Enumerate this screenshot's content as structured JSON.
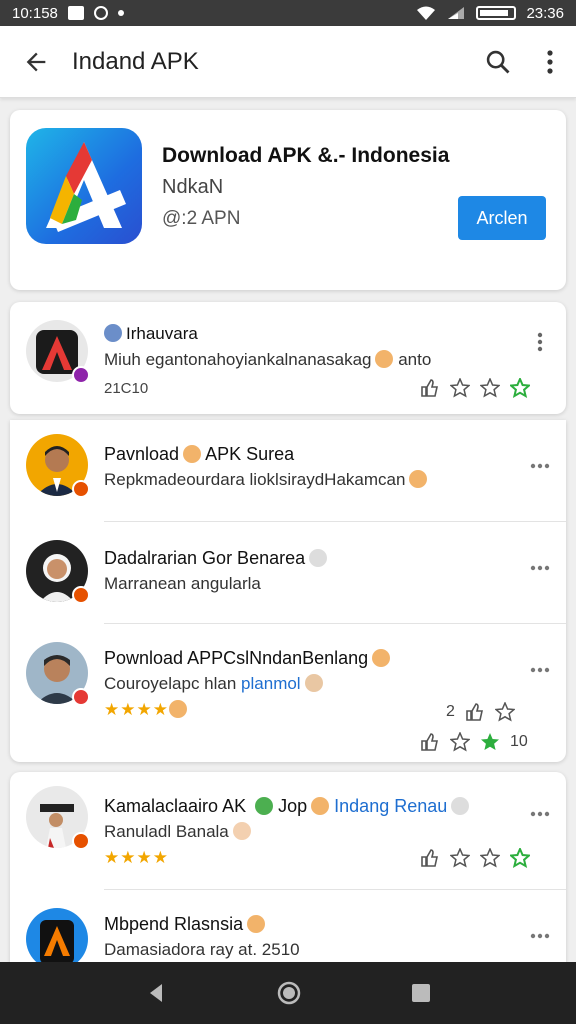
{
  "status_bar": {
    "time_left": "10:158",
    "time_right": "23:36"
  },
  "app_bar": {
    "title": "Indand APK"
  },
  "hero": {
    "app_name": "Download APK &.- Indonesia",
    "subtitle": "NdkaN",
    "meta": "@:2 APN",
    "button_label": "Arclen"
  },
  "featured": {
    "title": "Irhauvara",
    "text": "Miuh egantonahoyiankalnanasakag",
    "text_suffix": "anto",
    "date": "21C10"
  },
  "reviews": [
    {
      "title": "Pavnload",
      "title_b": "APK Surea",
      "text": "Repkmadeourdara lioklsiraydHakamcan"
    },
    {
      "title": "Dadalrarian Gor Benarea",
      "text": "Marranean angularla"
    },
    {
      "title": "Pownload APPCslNndanBenlang",
      "text": "Couroyelapc hlan",
      "text_blue": "planmol",
      "stars": "★★★★",
      "count_a": "2",
      "count_b": "10"
    }
  ],
  "section2": [
    {
      "title": "Kamalaclaairo AK",
      "title_b": "Jop",
      "title_blue": "Indang Renau",
      "text": "Ranuladl Banala",
      "stars": "★★★★"
    },
    {
      "title": "Mbpend Rlasnsia",
      "text": "Damasiadora ray at. 2510"
    }
  ],
  "colors": {
    "accent": "#1e88e5",
    "star": "#f2a600",
    "rate_star_green": "#2cae3d"
  }
}
